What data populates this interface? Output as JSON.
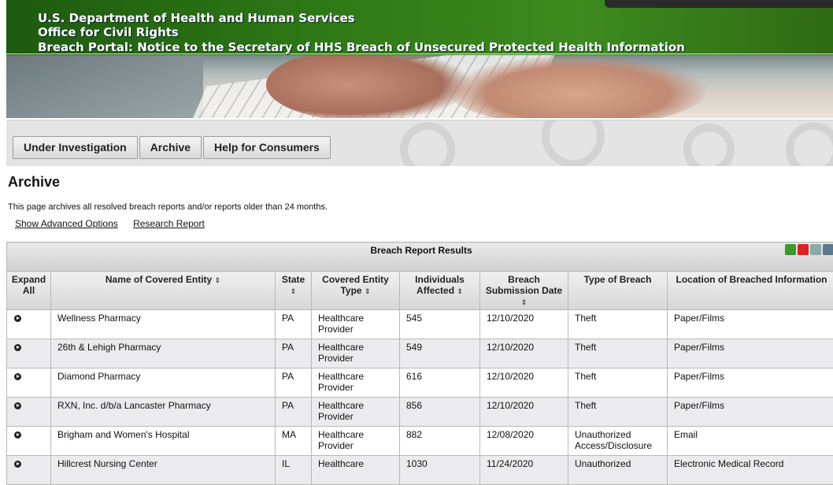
{
  "header": {
    "line1": "U.S. Department of Health and Human Services",
    "line2": "Office for Civil Rights",
    "line3": "Breach Portal: Notice to the Secretary of HHS Breach of Unsecured Protected Health Information"
  },
  "nav": {
    "tabs": [
      "Under Investigation",
      "Archive",
      "Help for Consumers"
    ]
  },
  "page": {
    "title": "Archive",
    "description": "This page archives all resolved breach reports and/or reports older than 24 months.",
    "links": [
      "Show Advanced Options",
      "Research Report"
    ]
  },
  "table": {
    "caption": "Breach Report Results",
    "sort_glyph": "⇕",
    "columns": {
      "expand": "Expand All",
      "name": "Name of Covered Entity",
      "state": "State",
      "entity_type": "Covered Entity Type",
      "individuals": "Individuals Affected",
      "date": "Breach Submission Date",
      "breach_type": "Type of Breach",
      "location": "Location of Breached Information"
    },
    "rows": [
      {
        "name": "Wellness Pharmacy",
        "state": "PA",
        "entity_type": "Healthcare Provider",
        "individuals": "545",
        "date": "12/10/2020",
        "breach_type": "Theft",
        "location": "Paper/Films"
      },
      {
        "name": "26th & Lehigh Pharmacy",
        "state": "PA",
        "entity_type": "Healthcare Provider",
        "individuals": "549",
        "date": "12/10/2020",
        "breach_type": "Theft",
        "location": "Paper/Films"
      },
      {
        "name": "Diamond Pharmacy",
        "state": "PA",
        "entity_type": "Healthcare Provider",
        "individuals": "616",
        "date": "12/10/2020",
        "breach_type": "Theft",
        "location": "Paper/Films"
      },
      {
        "name": "RXN, Inc. d/b/a Lancaster Pharmacy",
        "state": "PA",
        "entity_type": "Healthcare Provider",
        "individuals": "856",
        "date": "12/10/2020",
        "breach_type": "Theft",
        "location": "Paper/Films"
      },
      {
        "name": "Brigham and Women's Hospital",
        "state": "MA",
        "entity_type": "Healthcare Provider",
        "individuals": "882",
        "date": "12/08/2020",
        "breach_type": "Unauthorized Access/Disclosure",
        "location": "Email"
      },
      {
        "name": "Hillcrest Nursing Center",
        "state": "IL",
        "entity_type": "Healthcare",
        "individuals": "1030",
        "date": "11/24/2020",
        "breach_type": "Unauthorized",
        "location": "Electronic Medical Record"
      }
    ]
  },
  "icons": [
    "export-excel-icon",
    "export-pdf-icon",
    "export-csv-icon",
    "export-xml-icon"
  ],
  "colors": {
    "header_green": "#2f7a16",
    "row_alt": "#ebebed"
  }
}
